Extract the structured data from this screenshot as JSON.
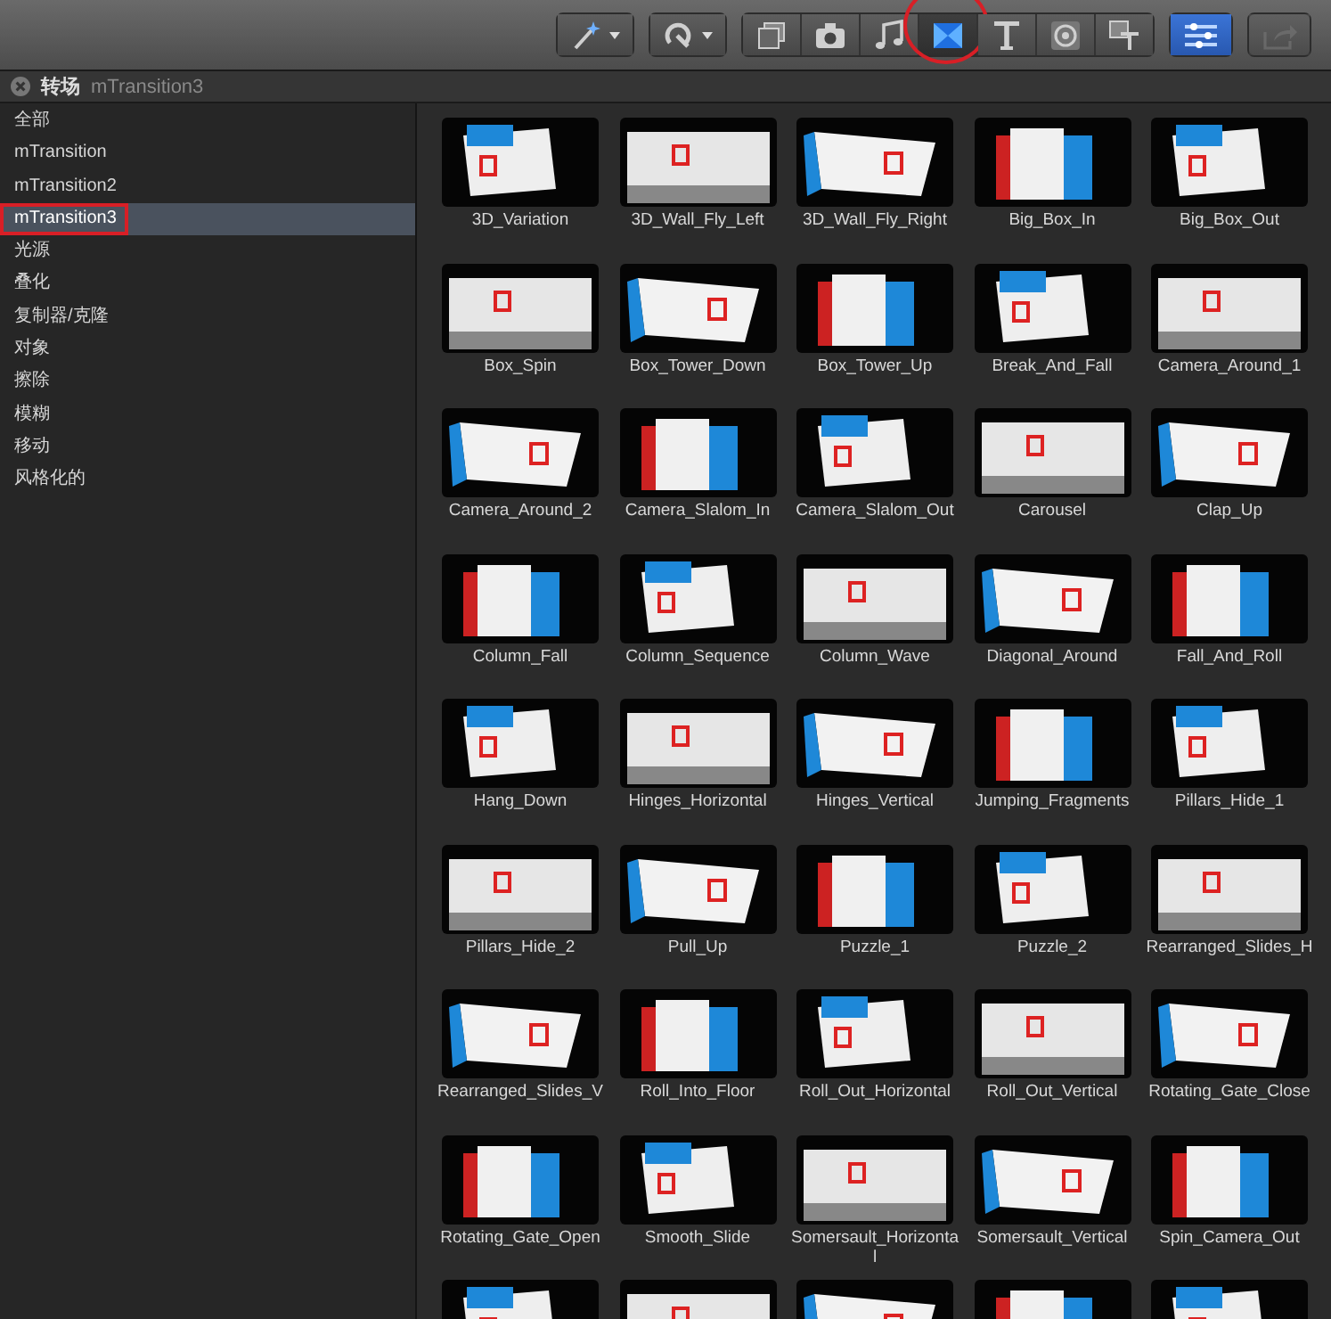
{
  "toolbar": {
    "groups": [
      {
        "buttons": [
          {
            "kind": "wand",
            "selected": false,
            "disabled": false,
            "annotated": false,
            "menu": true
          }
        ]
      },
      {
        "buttons": [
          {
            "kind": "retime",
            "selected": false,
            "disabled": false,
            "annotated": false,
            "menu": true
          }
        ]
      },
      {
        "buttons": [
          {
            "kind": "clips",
            "selected": false,
            "disabled": false,
            "annotated": false,
            "menu": false
          },
          {
            "kind": "photos",
            "selected": false,
            "disabled": false,
            "annotated": false,
            "menu": false
          },
          {
            "kind": "music",
            "selected": false,
            "disabled": false,
            "annotated": false,
            "menu": false
          },
          {
            "kind": "transitions",
            "selected": true,
            "disabled": false,
            "annotated": true,
            "menu": false
          },
          {
            "kind": "titles",
            "selected": false,
            "disabled": false,
            "annotated": false,
            "menu": false
          },
          {
            "kind": "generators",
            "selected": false,
            "disabled": false,
            "annotated": false,
            "menu": false
          },
          {
            "kind": "themes",
            "selected": false,
            "disabled": false,
            "annotated": false,
            "menu": false
          }
        ]
      },
      {
        "buttons": [
          {
            "kind": "inspector",
            "selected": true,
            "disabled": false,
            "annotated": false,
            "menu": false
          }
        ]
      },
      {
        "buttons": [
          {
            "kind": "share",
            "selected": false,
            "disabled": true,
            "annotated": false,
            "menu": false
          }
        ]
      }
    ]
  },
  "browser_header": {
    "title": "转场",
    "subtitle": "mTransition3"
  },
  "sidebar": {
    "items": [
      {
        "label": "全部",
        "selected": false,
        "annotated": false
      },
      {
        "label": "mTransition",
        "selected": false,
        "annotated": false
      },
      {
        "label": "mTransition2",
        "selected": false,
        "annotated": false
      },
      {
        "label": "mTransition3",
        "selected": true,
        "annotated": true
      },
      {
        "label": "光源",
        "selected": false,
        "annotated": false
      },
      {
        "label": "叠化",
        "selected": false,
        "annotated": false
      },
      {
        "label": "复制器/克隆",
        "selected": false,
        "annotated": false
      },
      {
        "label": "对象",
        "selected": false,
        "annotated": false
      },
      {
        "label": "擦除",
        "selected": false,
        "annotated": false
      },
      {
        "label": "模糊",
        "selected": false,
        "annotated": false
      },
      {
        "label": "移动",
        "selected": false,
        "annotated": false
      },
      {
        "label": "风格化的",
        "selected": false,
        "annotated": false
      }
    ]
  },
  "transitions": [
    {
      "kind": "full",
      "label": "3D_Variation"
    },
    {
      "kind": "full",
      "label": "3D_Wall_Fly_Left"
    },
    {
      "kind": "full",
      "label": "3D_Wall_Fly_Right"
    },
    {
      "kind": "full",
      "label": "Big_Box_In"
    },
    {
      "kind": "full",
      "label": "Big_Box_Out"
    },
    {
      "kind": "full",
      "label": "Box_Spin"
    },
    {
      "kind": "full",
      "label": "Box_Tower_Down"
    },
    {
      "kind": "full",
      "label": "Box_Tower_Up"
    },
    {
      "kind": "full",
      "label": "Break_And_Fall"
    },
    {
      "kind": "full",
      "label": "Camera_Around_1"
    },
    {
      "kind": "full",
      "label": "Camera_Around_2"
    },
    {
      "kind": "full",
      "label": "Camera_Slalom_In"
    },
    {
      "kind": "full",
      "label": "Camera_Slalom_Out"
    },
    {
      "kind": "full",
      "label": "Carousel"
    },
    {
      "kind": "full",
      "label": "Clap_Up"
    },
    {
      "kind": "full",
      "label": "Column_Fall"
    },
    {
      "kind": "full",
      "label": "Column_Sequence"
    },
    {
      "kind": "full",
      "label": "Column_Wave"
    },
    {
      "kind": "full",
      "label": "Diagonal_Around"
    },
    {
      "kind": "full",
      "label": "Fall_And_Roll"
    },
    {
      "kind": "full",
      "label": "Hang_Down"
    },
    {
      "kind": "full",
      "label": "Hinges_Horizontal"
    },
    {
      "kind": "full",
      "label": "Hinges_Vertical"
    },
    {
      "kind": "full",
      "label": "Jumping_Fragments"
    },
    {
      "kind": "full",
      "label": "Pillars_Hide_1"
    },
    {
      "kind": "full",
      "label": "Pillars_Hide_2"
    },
    {
      "kind": "full",
      "label": "Pull_Up"
    },
    {
      "kind": "full",
      "label": "Puzzle_1"
    },
    {
      "kind": "full",
      "label": "Puzzle_2"
    },
    {
      "kind": "full",
      "label": "Rearranged_Slides_H"
    },
    {
      "kind": "full",
      "label": "Rearranged_Slides_V"
    },
    {
      "kind": "full",
      "label": "Roll_Into_Floor"
    },
    {
      "kind": "full",
      "label": "Roll_Out_Horizontal"
    },
    {
      "kind": "full",
      "label": "Roll_Out_Vertical"
    },
    {
      "kind": "full",
      "label": "Rotating_Gate_Close"
    },
    {
      "kind": "full",
      "label": "Rotating_Gate_Open"
    },
    {
      "kind": "full",
      "label": "Smooth_Slide"
    },
    {
      "kind": "full",
      "label": "Somersault_Horizontal"
    },
    {
      "kind": "full",
      "label": "Somersault_Vertical"
    },
    {
      "kind": "full",
      "label": "Spin_Camera_Out"
    },
    {
      "kind": "cut_off"
    },
    {
      "kind": "cut_off"
    },
    {
      "kind": "cut_off"
    },
    {
      "kind": "cut_off"
    },
    {
      "kind": "cut_off"
    }
  ]
}
